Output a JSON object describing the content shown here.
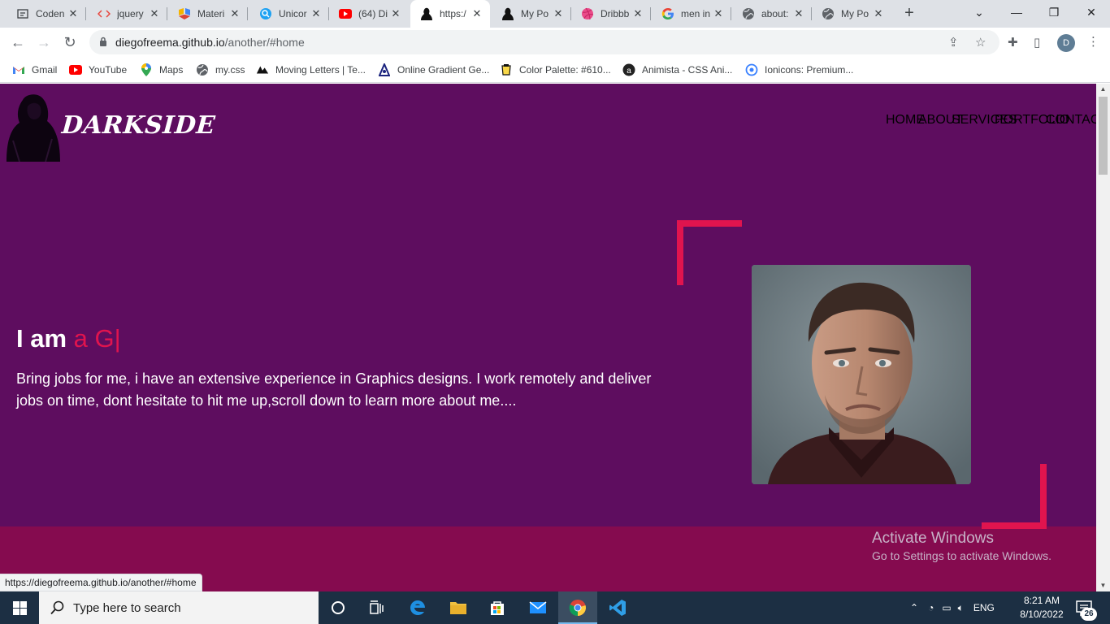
{
  "browser": {
    "tabs": [
      {
        "label": "Coden",
        "icon": "codepen-icon",
        "active": false
      },
      {
        "label": "jquery",
        "icon": "code-brackets-icon",
        "active": false
      },
      {
        "label": "Materi",
        "icon": "material-icon",
        "active": false
      },
      {
        "label": "Unicor",
        "icon": "unicorn-icon",
        "active": false
      },
      {
        "label": "(64) Di",
        "icon": "youtube-icon",
        "active": false
      },
      {
        "label": "https:/",
        "icon": "darkside-icon",
        "active": true
      },
      {
        "label": "My Po",
        "icon": "darkside-icon",
        "active": false
      },
      {
        "label": "Dribbb",
        "icon": "dribbble-icon",
        "active": false
      },
      {
        "label": "men in",
        "icon": "google-icon",
        "active": false
      },
      {
        "label": "about:",
        "icon": "globe-icon",
        "active": false
      },
      {
        "label": "My Po",
        "icon": "globe-icon",
        "active": false
      }
    ],
    "new_tab": "+",
    "url_host": "diegofreema.github.io",
    "url_path": "/another/#home",
    "profile_initial": "D",
    "bookmarks": [
      {
        "label": "Gmail",
        "icon": "gmail-icon"
      },
      {
        "label": "YouTube",
        "icon": "youtube-icon"
      },
      {
        "label": "Maps",
        "icon": "maps-icon"
      },
      {
        "label": "my.css",
        "icon": "globe-icon"
      },
      {
        "label": "Moving Letters | Te...",
        "icon": "moving-letters-icon"
      },
      {
        "label": "Online Gradient Ge...",
        "icon": "gradient-icon"
      },
      {
        "label": "Color Palette: #610...",
        "icon": "palette-icon"
      },
      {
        "label": "Animista - CSS Ani...",
        "icon": "animista-icon"
      },
      {
        "label": "Ionicons: Premium...",
        "icon": "ionicons-icon"
      }
    ],
    "status_url": "https://diegofreema.github.io/another/#home"
  },
  "site": {
    "brand": "DARKSIDE",
    "nav": [
      {
        "label": "HOME",
        "active": true
      },
      {
        "label": "ABOUT",
        "active": false
      },
      {
        "label": "SERVICES",
        "active": false
      },
      {
        "label": "PORTFOLIO",
        "active": false
      },
      {
        "label": "CONTACT",
        "active": false
      }
    ],
    "hero": {
      "prefix": "I am ",
      "typed": "a G",
      "caret": "|",
      "text": "Bring jobs for me, i have an extensive experience in Graphics designs. I work remotely and deliver jobs on time, dont hesitate to hit me up,scroll down to learn more about me...."
    },
    "colors": {
      "background": "#5e0d5f",
      "accent": "#e0144e",
      "next_section": "#850b4f"
    }
  },
  "watermark": {
    "line1": "Activate Windows",
    "line2": "Go to Settings to activate Windows."
  },
  "taskbar": {
    "search_placeholder": "Type here to search",
    "language": "ENG",
    "time": "8:21 AM",
    "date": "8/10/2022",
    "notification_count": "26"
  }
}
